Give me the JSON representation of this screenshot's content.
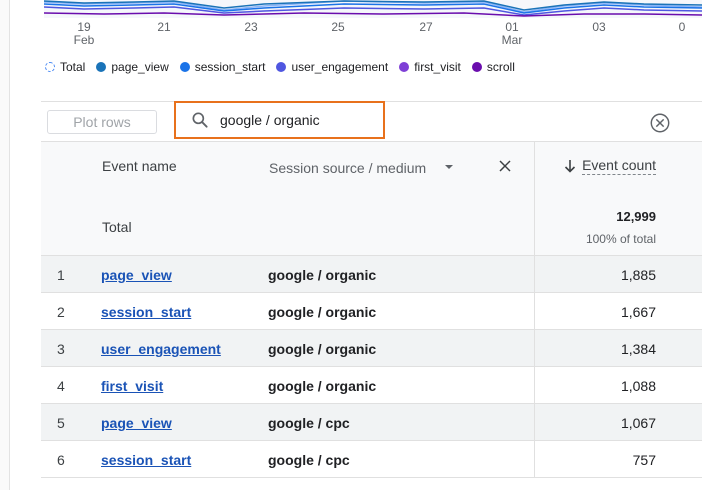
{
  "chart": {
    "x_ticks": [
      {
        "day": "19",
        "month": "Feb"
      },
      {
        "day": "21",
        "month": ""
      },
      {
        "day": "23",
        "month": ""
      },
      {
        "day": "25",
        "month": ""
      },
      {
        "day": "27",
        "month": ""
      },
      {
        "day": "01",
        "month": "Mar"
      },
      {
        "day": "03",
        "month": ""
      },
      {
        "day": "0",
        "month": ""
      }
    ]
  },
  "legend": [
    {
      "label": "Total",
      "color": "#4285f4",
      "style": "dashed"
    },
    {
      "label": "page_view",
      "color": "#1a73b8"
    },
    {
      "label": "session_start",
      "color": "#1a73e8"
    },
    {
      "label": "user_engagement",
      "color": "#4f56e0"
    },
    {
      "label": "first_visit",
      "color": "#7e3fd6"
    },
    {
      "label": "scroll",
      "color": "#6a0dad"
    }
  ],
  "toolbar": {
    "plot_rows_label": "Plot rows",
    "search_value": "google / organic"
  },
  "table": {
    "headers": {
      "event_name": "Event name",
      "session_source": "Session source / medium",
      "event_count": "Event count"
    },
    "total": {
      "label": "Total",
      "value": "12,999",
      "percent": "100% of total"
    },
    "rows": [
      {
        "num": "1",
        "event": "page_view",
        "source": "google / organic",
        "count": "1,885"
      },
      {
        "num": "2",
        "event": "session_start",
        "source": "google / organic",
        "count": "1,667"
      },
      {
        "num": "3",
        "event": "user_engagement",
        "source": "google / organic",
        "count": "1,384"
      },
      {
        "num": "4",
        "event": "first_visit",
        "source": "google / organic",
        "count": "1,088"
      },
      {
        "num": "5",
        "event": "page_view",
        "source": "google / cpc",
        "count": "1,067"
      },
      {
        "num": "6",
        "event": "session_start",
        "source": "google / cpc",
        "count": "757"
      }
    ]
  }
}
